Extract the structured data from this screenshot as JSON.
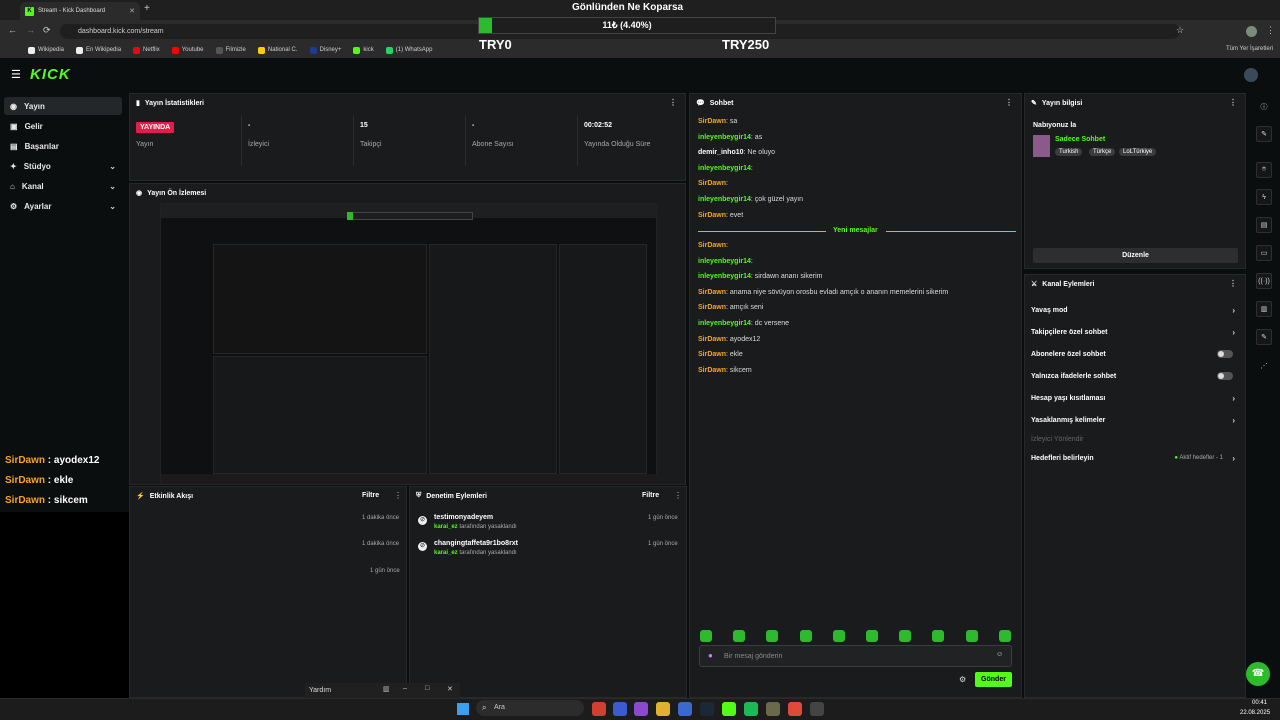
{
  "browser": {
    "tab_title": "Stream - Kick Dashboard",
    "url": "dashboard.kick.com/stream",
    "bookmarks": [
      "Wikipedia",
      "En Wikipedia",
      "Netflix",
      "Youtube",
      "Filmizle",
      "National C.",
      "Disney+",
      "kick",
      "(1) WhatsApp"
    ],
    "all_bookmarks": "Tüm Yer İşaretleri"
  },
  "overlay": {
    "goal_title": "Gönlünden Ne Koparsa",
    "goal_text": "11₺ (4.40%)",
    "goal_progress": 0.044,
    "min_label": "TRY0",
    "max_label": "TRY250",
    "chat": [
      {
        "user": "SirDawn",
        "msg": " : ayodex12"
      },
      {
        "user": "SirDawn",
        "msg": " : ekle"
      },
      {
        "user": "SirDawn",
        "msg": " : sikcem"
      }
    ]
  },
  "sidebar": {
    "items": [
      {
        "label": "Yayın"
      },
      {
        "label": "Gelir"
      },
      {
        "label": "Başarılar"
      },
      {
        "label": "Stüdyo"
      },
      {
        "label": "Kanal"
      },
      {
        "label": "Ayarlar"
      }
    ]
  },
  "stats": {
    "title": "Yayın İstatistikleri",
    "live_badge": "YAYINDA",
    "cells": [
      {
        "value": "",
        "label": "Yayın"
      },
      {
        "value": "-",
        "label": "İzleyici"
      },
      {
        "value": "15",
        "label": "Takipçi"
      },
      {
        "value": "-",
        "label": "Abone Sayısı"
      },
      {
        "value": "00:02:52",
        "label": "Yayında Olduğu Süre"
      }
    ]
  },
  "preview": {
    "title": "Yayın Ön İzlemesi"
  },
  "activity": {
    "title": "Etkinlik Akışı",
    "filter": "Filtre",
    "times": [
      "1 dakika önce",
      "1 dakika önce",
      "1 gün önce"
    ]
  },
  "moderation": {
    "title": "Denetim Eylemleri",
    "filter": "Filtre",
    "items": [
      {
        "name": "testimonyadeyem",
        "by": "karai_ez",
        "suffix": " tarafından yasaklandı",
        "time": "1 gün önce"
      },
      {
        "name": "changingtaffeta9r1bo8rxt",
        "by": "karai_ez",
        "suffix": " tarafından yasaklandı",
        "time": "1 gün önce"
      }
    ]
  },
  "chat": {
    "title": "Sohbet",
    "new_messages": "Yeni mesajlar",
    "placeholder": "Bir mesaj gönderin",
    "send": "Gönder",
    "messages_before": [
      {
        "user": "SirDawn",
        "c": "o",
        "msg": ": sa"
      },
      {
        "user": "inleyenbeygir14",
        "c": "g",
        "msg": ": as"
      },
      {
        "user": "demir_inho10",
        "c": "w",
        "msg": ": Ne oluyo"
      },
      {
        "user": "inleyenbeygir14",
        "c": "g",
        "msg": ":"
      },
      {
        "user": "SirDawn",
        "c": "o",
        "msg": ":"
      },
      {
        "user": "inleyenbeygir14",
        "c": "g",
        "msg": ": çok güzel yayın"
      },
      {
        "user": "SirDawn",
        "c": "o",
        "msg": ": evet"
      }
    ],
    "messages_after": [
      {
        "user": "SirDawn",
        "c": "o",
        "msg": ":"
      },
      {
        "user": "inleyenbeygir14",
        "c": "g",
        "msg": ":"
      },
      {
        "user": "inleyenbeygir14",
        "c": "g",
        "msg": ": sirdawn ananı sikerim"
      },
      {
        "user": "SirDawn",
        "c": "o",
        "msg": ": anama niye sövüyon orosbu evladı amçık o ananın memelerini sikerim"
      },
      {
        "user": "SirDawn",
        "c": "o",
        "msg": ": amçık seni"
      },
      {
        "user": "inleyenbeygir14",
        "c": "g",
        "msg": ": dc versene"
      },
      {
        "user": "SirDawn",
        "c": "o",
        "msg": ": ayodex12"
      },
      {
        "user": "SirDawn",
        "c": "o",
        "msg": ": ekle"
      },
      {
        "user": "SirDawn",
        "c": "o",
        "msg": ": sikcem"
      }
    ]
  },
  "stream_info": {
    "title": "Yayın bilgisi",
    "stream_title": "Nabıyonuz la",
    "category": "Sadece Sohbet",
    "tags": [
      "Turkish",
      "Türkçe",
      "LoLTürkiye"
    ],
    "edit": "Düzenle"
  },
  "channel_actions": {
    "title": "Kanal Eylemleri",
    "items": [
      {
        "label": "Yavaş mod",
        "kind": "chev"
      },
      {
        "label": "Takipçilere özel sohbet",
        "kind": "chev"
      },
      {
        "label": "Abonelere özel sohbet",
        "kind": "toggle"
      },
      {
        "label": "Yalnızca ifadelerle sohbet",
        "kind": "toggle"
      },
      {
        "label": "Hesap yaşı kısıtlaması",
        "kind": "chev"
      },
      {
        "label": "Yasaklanmış kelimeler",
        "kind": "chev"
      }
    ],
    "section": "İzleyici Yönlendir",
    "targets_label": "Hedefleri belirleyin",
    "targets_status": "Aktif hedefler - 1"
  },
  "popup_bar": {
    "help": "Yardım"
  },
  "taskbar": {
    "search": "Ara",
    "time": "00:41",
    "date": "22.08.2025"
  },
  "colors": {
    "accent": "#53fc18",
    "live": "#e11d48",
    "orange_user": "#f5a524"
  }
}
